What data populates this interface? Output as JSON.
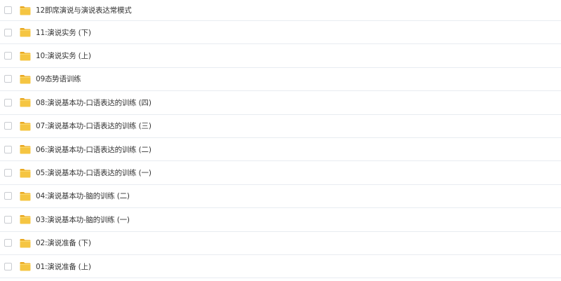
{
  "colors": {
    "folder_body": "#f5c542",
    "folder_tab": "#e9a820",
    "row_border": "#e8ecf1",
    "text": "#333333"
  },
  "files": [
    {
      "name": "12即席演说与演说表达常模式",
      "icon": "folder-icon"
    },
    {
      "name": "11:演说实务 (下)",
      "icon": "folder-icon"
    },
    {
      "name": "10:演说实务 (上)",
      "icon": "folder-icon"
    },
    {
      "name": "09态势语训练",
      "icon": "folder-icon"
    },
    {
      "name": "08:演说基本功-口语表达的训练 (四)",
      "icon": "folder-icon"
    },
    {
      "name": "07:演说基本功-口语表达的训练 (三)",
      "icon": "folder-icon"
    },
    {
      "name": "06:演说基本功-口语表达的训练 (二)",
      "icon": "folder-icon"
    },
    {
      "name": "05:演说基本功-口语表达的训练 (一)",
      "icon": "folder-icon"
    },
    {
      "name": "04:演说基本功-脑的训练 (二)",
      "icon": "folder-icon"
    },
    {
      "name": "03:演说基本功-脑的训练 (一)",
      "icon": "folder-icon"
    },
    {
      "name": "02:演说准备 (下)",
      "icon": "folder-icon"
    },
    {
      "name": "01:演说准备 (上)",
      "icon": "folder-icon"
    }
  ]
}
